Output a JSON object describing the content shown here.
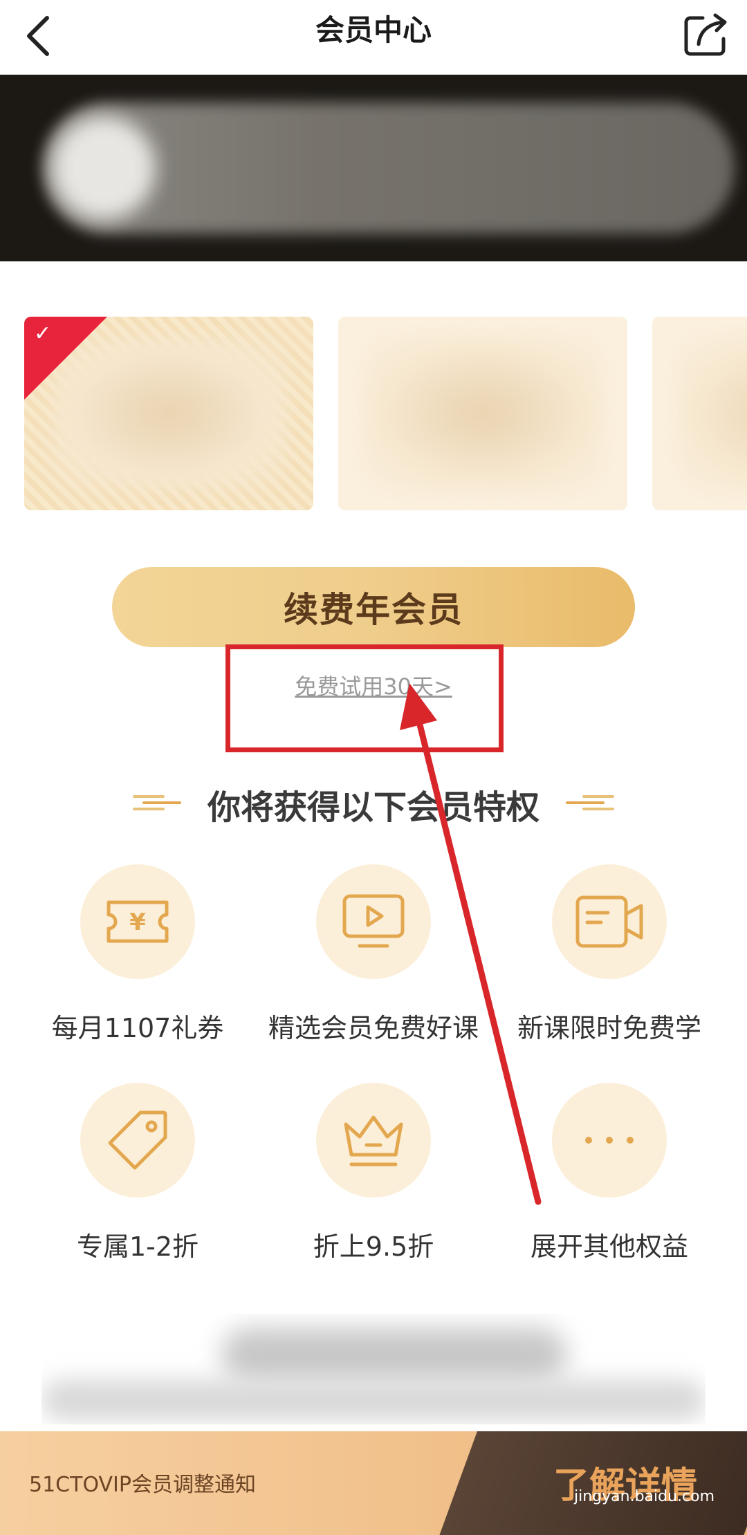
{
  "header": {
    "title": "会员中心"
  },
  "renew": {
    "label": "续费年会员"
  },
  "trial": {
    "label": "免费试用30天>"
  },
  "section": {
    "title": "你将获得以下会员特权"
  },
  "benefits": [
    {
      "label": "每月1107礼券",
      "icon": "ticket-icon"
    },
    {
      "label": "精选会员免费好课",
      "icon": "video-screen-icon"
    },
    {
      "label": "新课限时免费学",
      "icon": "video-camera-icon"
    },
    {
      "label": "专属1-2折",
      "icon": "price-tag-icon"
    },
    {
      "label": "折上9.5折",
      "icon": "crown-icon"
    },
    {
      "label": "展开其他权益",
      "icon": "more-dots-icon"
    }
  ],
  "bottom": {
    "notice": "51CTOVIP会员调整通知",
    "detail": "了解详情"
  },
  "watermark": "jingyan.baidu.com",
  "colors": {
    "accent_gold": "#e9bb6a",
    "icon_gold": "#e3a84f",
    "annotation_red": "#d9262b"
  }
}
